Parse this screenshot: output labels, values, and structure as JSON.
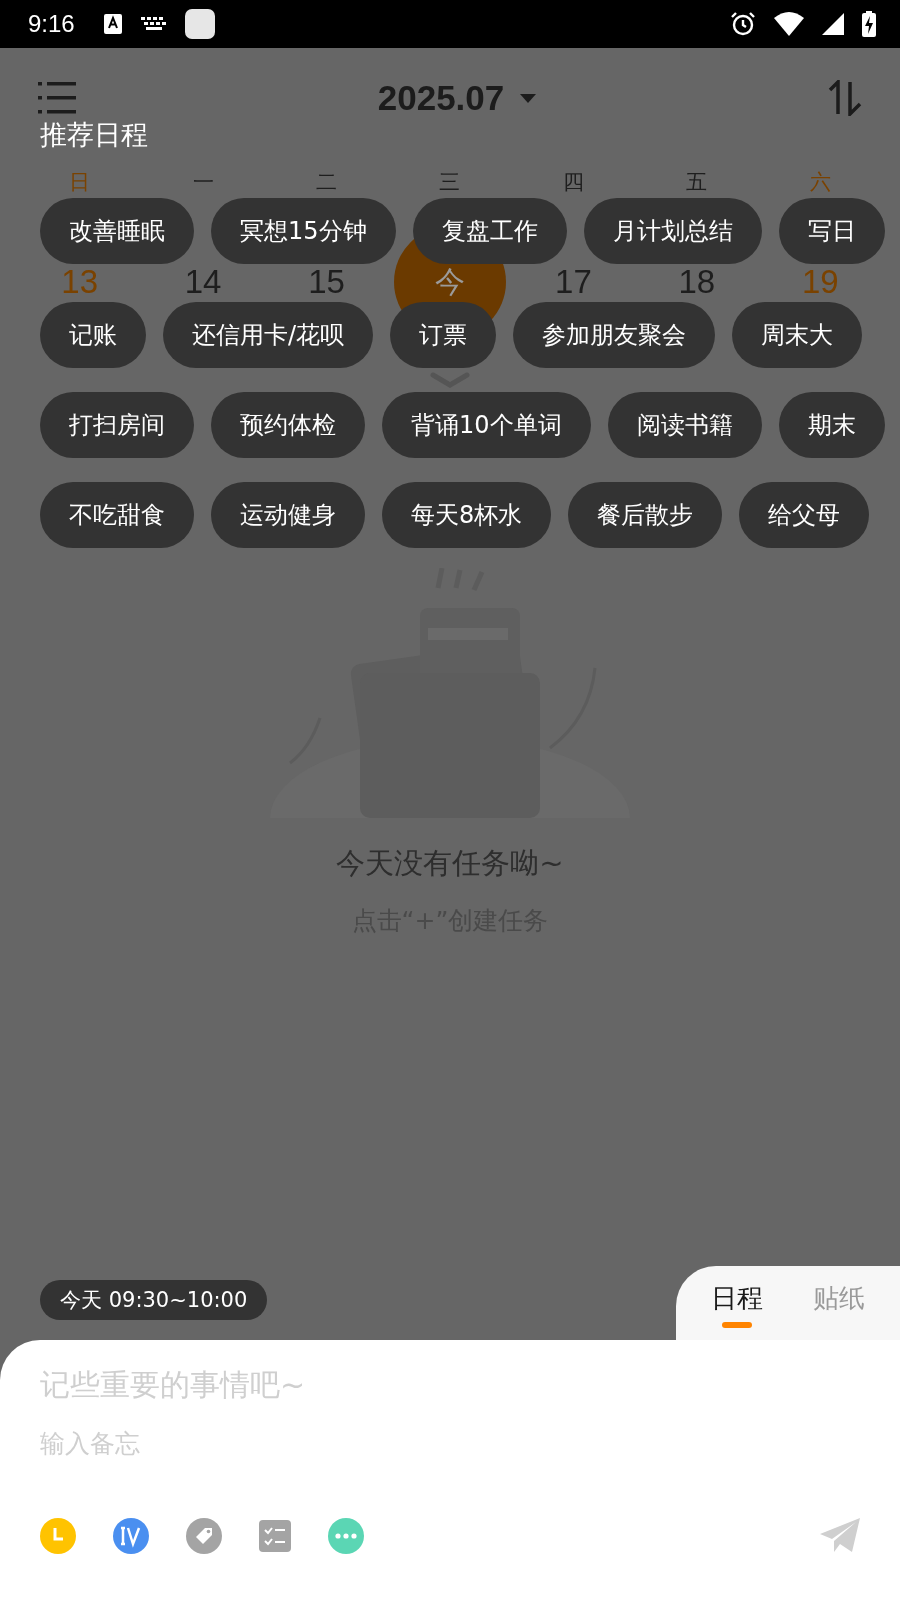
{
  "status_bar": {
    "time": "9:16"
  },
  "header": {
    "title": "2025.07"
  },
  "week": [
    {
      "weekday": "日",
      "date": "13",
      "color": "#7a4200",
      "today": false
    },
    {
      "weekday": "一",
      "date": "14",
      "color": "#1e1e1e",
      "today": false
    },
    {
      "weekday": "二",
      "date": "15",
      "color": "#1e1e1e",
      "today": false
    },
    {
      "weekday": "三",
      "date": "今",
      "color": "#1e1e1e",
      "today": true
    },
    {
      "weekday": "四",
      "date": "17",
      "color": "#1e1e1e",
      "today": false
    },
    {
      "weekday": "五",
      "date": "18",
      "color": "#1e1e1e",
      "today": false
    },
    {
      "weekday": "六",
      "date": "19",
      "color": "#7a4200",
      "today": false
    }
  ],
  "empty_state": {
    "title": "今天没有任务呦~",
    "hint": "点击“+”创建任务"
  },
  "recommend": {
    "title": "推荐日程",
    "rows": [
      {
        "chips": [
          "改善睡眠",
          "冥想15分钟",
          "复盘工作",
          "月计划总结",
          "写日"
        ]
      },
      {
        "chips": [
          "记账",
          "还信用卡/花呗",
          "订票",
          "参加朋友聚会",
          "周末大"
        ]
      },
      {
        "chips": [
          "打扫房间",
          "预约体检",
          "背诵10个单词",
          "阅读书籍",
          "期末"
        ]
      },
      {
        "chips": [
          "不吃甜食",
          "运动健身",
          "每天8杯水",
          "餐后散步",
          "给父母"
        ]
      }
    ]
  },
  "time_chip": "今天 09:30~10:00",
  "tabs": [
    {
      "label": "日程",
      "selected": true
    },
    {
      "label": "贴纸",
      "selected": false
    }
  ],
  "compose": {
    "title_placeholder": "记些重要的事情吧~",
    "note_placeholder": "输入备忘"
  }
}
